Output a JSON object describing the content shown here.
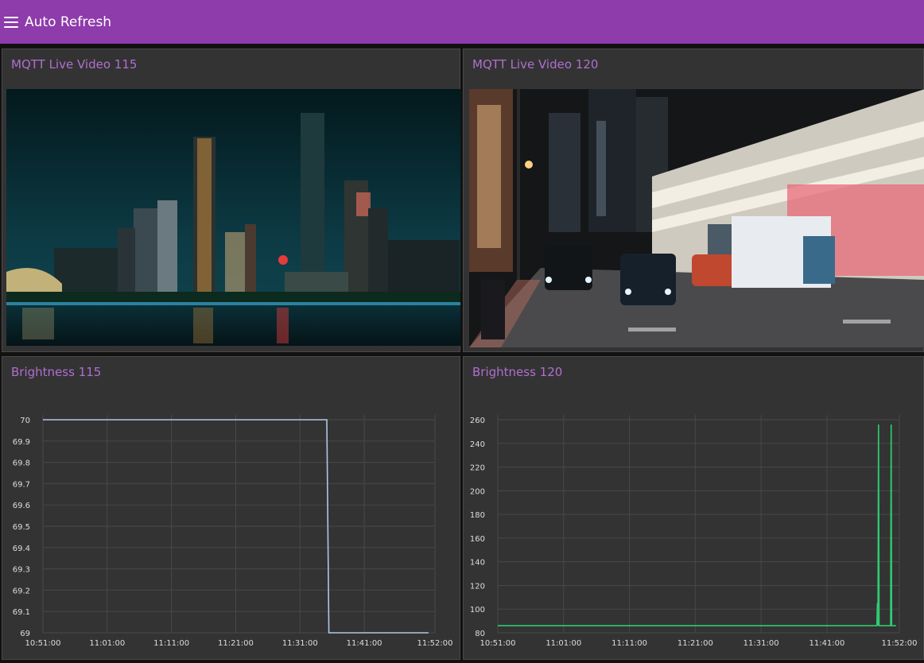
{
  "header": {
    "title": "Auto Refresh",
    "menu_icon": "hamburger-menu-icon"
  },
  "colors": {
    "header": "#8e3bab",
    "card_title": "#b06fd0",
    "card_bg": "#333333",
    "series_115": "#aec7e8",
    "series_120": "#2ecc71"
  },
  "panels": {
    "video115": {
      "title": "MQTT Live Video 115",
      "image": "night city skyline across river"
    },
    "video120": {
      "title": "MQTT Live Video 120",
      "image": "night city street with taxis and truck"
    },
    "brightness115": {
      "title": "Brightness 115"
    },
    "brightness120": {
      "title": "Brightness 120"
    }
  },
  "chart_data": [
    {
      "type": "line",
      "title": "Brightness 115",
      "x_ticks": [
        "10:51:00",
        "11:01:00",
        "11:11:00",
        "11:21:00",
        "11:31:00",
        "11:41:00",
        "11:52:00"
      ],
      "y_ticks": [
        "70",
        "69.9",
        "69.8",
        "69.7",
        "69.6",
        "69.5",
        "69.4",
        "69.3",
        "69.2",
        "69.1",
        "69"
      ],
      "ylim": [
        69,
        70
      ],
      "xlim": [
        "10:51:00",
        "11:52:00"
      ],
      "grid": true,
      "series": [
        {
          "color": "#aec7e8",
          "points": [
            {
              "x": "10:51:00",
              "y": 70
            },
            {
              "x": "11:35:10",
              "y": 70
            },
            {
              "x": "11:35:30",
              "y": 69
            },
            {
              "x": "11:51:00",
              "y": 69
            }
          ]
        }
      ]
    },
    {
      "type": "line",
      "title": "Brightness 120",
      "x_ticks": [
        "10:51:00",
        "11:01:00",
        "11:11:00",
        "11:21:00",
        "11:31:00",
        "11:41:00",
        "11:52:00"
      ],
      "y_ticks": [
        "260",
        "240",
        "220",
        "200",
        "180",
        "160",
        "140",
        "120",
        "100",
        "80"
      ],
      "ylim": [
        80,
        260
      ],
      "xlim": [
        "10:51:00",
        "11:52:00"
      ],
      "grid": true,
      "series": [
        {
          "color": "#2ecc71",
          "points": [
            {
              "x": "10:51:00",
              "y": 86
            },
            {
              "x": "11:48:35",
              "y": 86
            },
            {
              "x": "11:48:40",
              "y": 105
            },
            {
              "x": "11:48:45",
              "y": 86
            },
            {
              "x": "11:48:50",
              "y": 256
            },
            {
              "x": "11:48:55",
              "y": 86
            },
            {
              "x": "11:50:40",
              "y": 86
            },
            {
              "x": "11:50:45",
              "y": 256
            },
            {
              "x": "11:50:50",
              "y": 86
            },
            {
              "x": "11:51:30",
              "y": 86
            }
          ]
        }
      ]
    }
  ]
}
